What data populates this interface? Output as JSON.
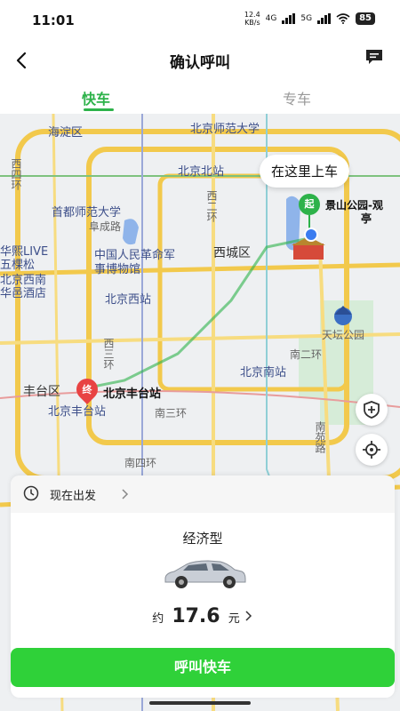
{
  "status_bar": {
    "time": "11:01",
    "net_speed_top": "12.4",
    "net_speed_bottom": "KB/s",
    "net_type": "4G",
    "net_type2": "5G",
    "battery": "85"
  },
  "nav": {
    "title": "确认呼叫"
  },
  "tabs": [
    {
      "label": "快车",
      "active": true
    },
    {
      "label": "专车",
      "active": false
    }
  ],
  "map": {
    "pickup_bubble": "在这里上车",
    "start_tag": "起",
    "start_label_line1": "景山公园-观",
    "start_label_line2": "亭",
    "end_tag": "终",
    "end_label": "北京丰台站",
    "labels": {
      "haidian": "海淀区",
      "bnu": "北京师范大学",
      "bjnorth": "北京北站",
      "xisi": "西四环",
      "shoushi": "首都师范大学",
      "fucheng": "阜成路",
      "xierhuan": "西二环",
      "junbo": "中国人民革命军事博物馆",
      "xicheng": "西城区",
      "bjwest": "北京西站",
      "wukesong": "华熙LIVE五棵松",
      "xinan": "北京西南华邑酒店",
      "xisanhuan": "西三环",
      "bjsouth": "北京南站",
      "nanerhuan": "南二环",
      "tiantan": "天坛公园",
      "fengtai": "丰台区",
      "fengtaistation": "北京丰台站",
      "nansanhuan": "南三环",
      "nanyuan": "南苑路",
      "nansihuan": "南四环"
    },
    "colors": {
      "ring_road": "#f2c94c",
      "metro_green": "#2db24a",
      "water": "#7fa8e6",
      "park": "#cfe8d2"
    }
  },
  "panel": {
    "depart": "现在出发",
    "car_type": "经济型",
    "price_prefix": "约",
    "price": "17.6",
    "price_unit": "元",
    "call_button": "呼叫快车"
  },
  "colors": {
    "accent": "#2db24a",
    "button": "#2fd139"
  }
}
